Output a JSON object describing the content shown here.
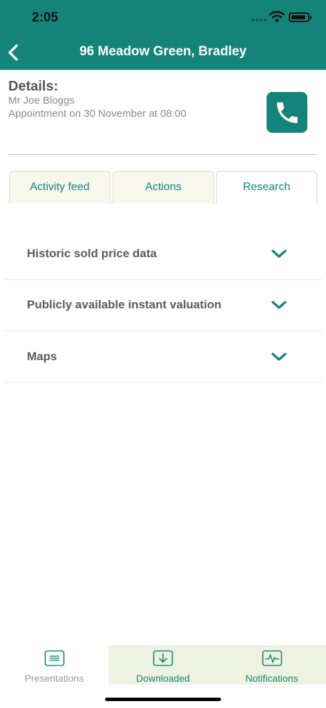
{
  "status_bar": {
    "time": "2:05"
  },
  "header": {
    "title": "96 Meadow Green, Bradley"
  },
  "details": {
    "heading": "Details:",
    "name": "Mr Joe Bloggs",
    "appointment": "Appointment on 30 November at 08:00"
  },
  "tabs": [
    {
      "label": "Activity feed",
      "active": false
    },
    {
      "label": "Actions",
      "active": false
    },
    {
      "label": "Research",
      "active": true
    }
  ],
  "research_sections": [
    {
      "label": "Historic sold price data"
    },
    {
      "label": "Publicly available instant valuation"
    },
    {
      "label": "Maps"
    }
  ],
  "bottom_tabs": [
    {
      "label": "Presentations",
      "icon": "presentation-icon",
      "selected": false
    },
    {
      "label": "Downloaded",
      "icon": "download-icon",
      "selected": true
    },
    {
      "label": "Notifications",
      "icon": "activity-icon",
      "selected": true
    }
  ],
  "colors": {
    "accent": "#14847a",
    "tab_bar_shade": "#eef2e0",
    "muted_label": "#9a9a9a"
  }
}
